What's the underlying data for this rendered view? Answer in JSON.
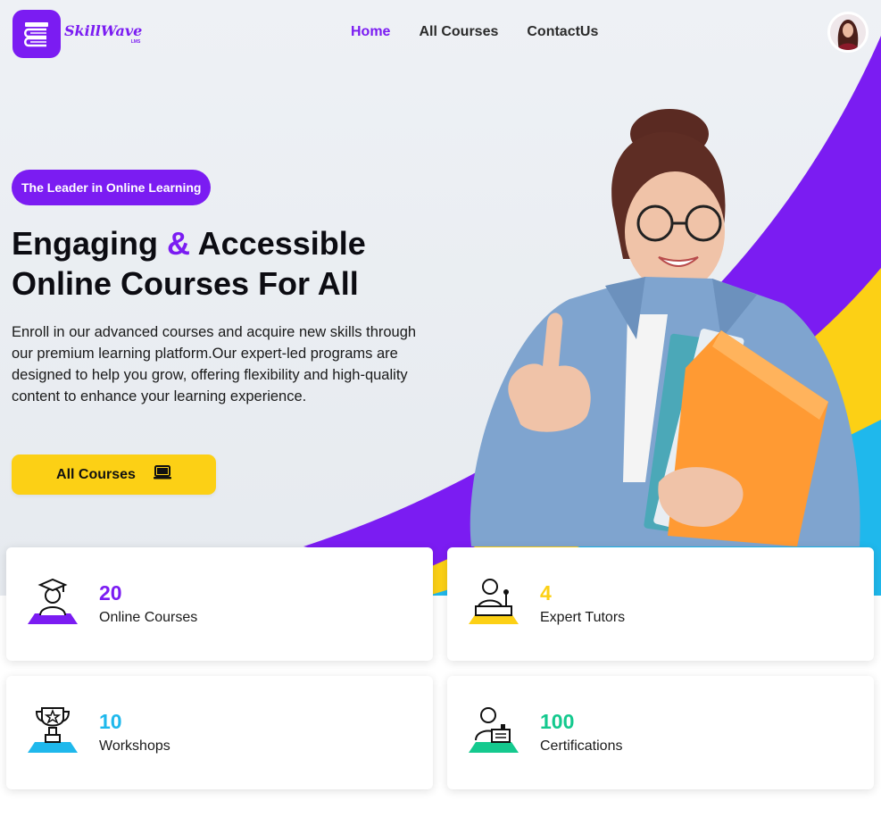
{
  "brand": {
    "name": "SkillWave",
    "sub": "LMS",
    "color": "#7b1cf2"
  },
  "nav": {
    "items": [
      {
        "label": "Home",
        "active": true
      },
      {
        "label": "All Courses",
        "active": false
      },
      {
        "label": "ContactUs",
        "active": false
      }
    ]
  },
  "hero": {
    "badge": "The Leader in Online Learning",
    "headline_part1": "Engaging ",
    "headline_amp": "&",
    "headline_part2": " Accessible Online Courses For All",
    "description": "Enroll in our advanced courses and acquire new skills through our premium learning platform.Our expert-led programs are designed to help you grow, offering flexibility and high-quality content to enhance your learning experience.",
    "cta_label": "All Courses",
    "cta_icon": "laptop-icon"
  },
  "colors": {
    "purple": "#7b1cf2",
    "yellow": "#fcd015",
    "blue": "#1fb8ec",
    "green": "#14c98e"
  },
  "stats": [
    {
      "value": "20",
      "label": "Online Courses",
      "color": "#7b1cf2",
      "icon": "graduate-icon"
    },
    {
      "value": "4",
      "label": "Expert Tutors",
      "color": "#fcd015",
      "icon": "tutor-icon"
    },
    {
      "value": "10",
      "label": "Workshops",
      "color": "#1fb8ec",
      "icon": "trophy-icon"
    },
    {
      "value": "100",
      "label": "Certifications",
      "color": "#14c98e",
      "icon": "certificate-icon"
    }
  ]
}
